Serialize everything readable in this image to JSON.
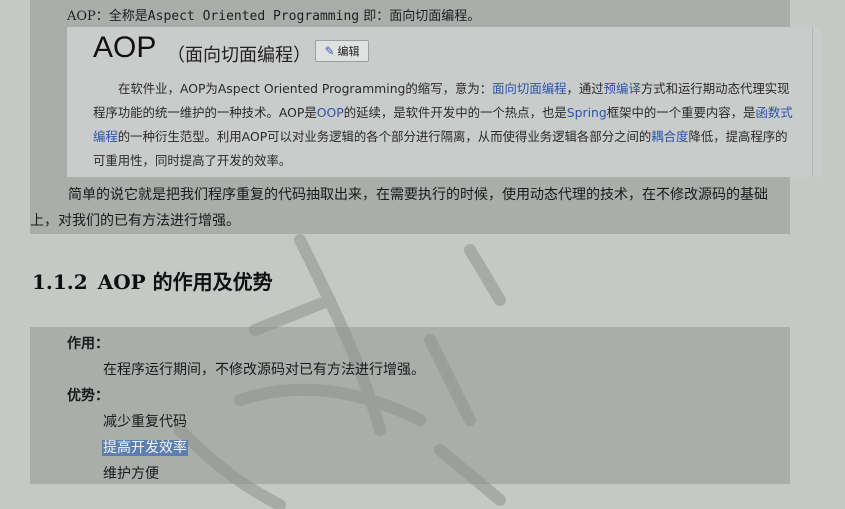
{
  "intro": {
    "prefix": "AOP：全称是",
    "term": "Aspect Oriented Programming",
    "suffix": "即：面向切面编程。"
  },
  "baike": {
    "title": "AOP",
    "subtitle": "（面向切面编程）",
    "edit_label": "编辑",
    "body": [
      {
        "t": "在软件业，AOP为Aspect Oriented Programming的缩写，意为："
      },
      {
        "t": "面向切面编程",
        "link": true
      },
      {
        "t": "，通过"
      },
      {
        "t": "预编译",
        "link": true
      },
      {
        "t": "方式和运行期动态代理实现程序功能的统一维护的一种技术。AOP是"
      },
      {
        "t": "OOP",
        "link": true
      },
      {
        "t": "的延续，是软件开发中的一个热点，也是"
      },
      {
        "t": "Spring",
        "link": true
      },
      {
        "t": "框架中的一个重要内容，是"
      },
      {
        "t": "函数式编程",
        "link": true
      },
      {
        "t": "的一种衍生范型。利用AOP可以对业务逻辑的各个部分进行隔离，从而使得业务逻辑各部分之间的"
      },
      {
        "t": "耦合度",
        "link": true
      },
      {
        "t": "降低，提高程序的可重用性，同时提高了开发的效率。"
      }
    ]
  },
  "paragraph": "简单的说它就是把我们程序重复的代码抽取出来，在需要执行的时候，使用动态代理的技术，在不修改源码的基础上，对我们的已有方法进行增强。",
  "section": {
    "number": "1.1.2",
    "title": "AOP 的作用及优势"
  },
  "function": {
    "label": "作用：",
    "text": "在程序运行期间，不修改源码对已有方法进行增强。"
  },
  "advantages": {
    "label": "优势：",
    "items": [
      "减少重复代码",
      "提高开发效率",
      "维护方便"
    ],
    "selected_index": 1
  },
  "colors": {
    "link": "#2a55a8",
    "selection": "#5d7fb0",
    "band": "#a9aeab",
    "background": "#c4c9c6"
  }
}
